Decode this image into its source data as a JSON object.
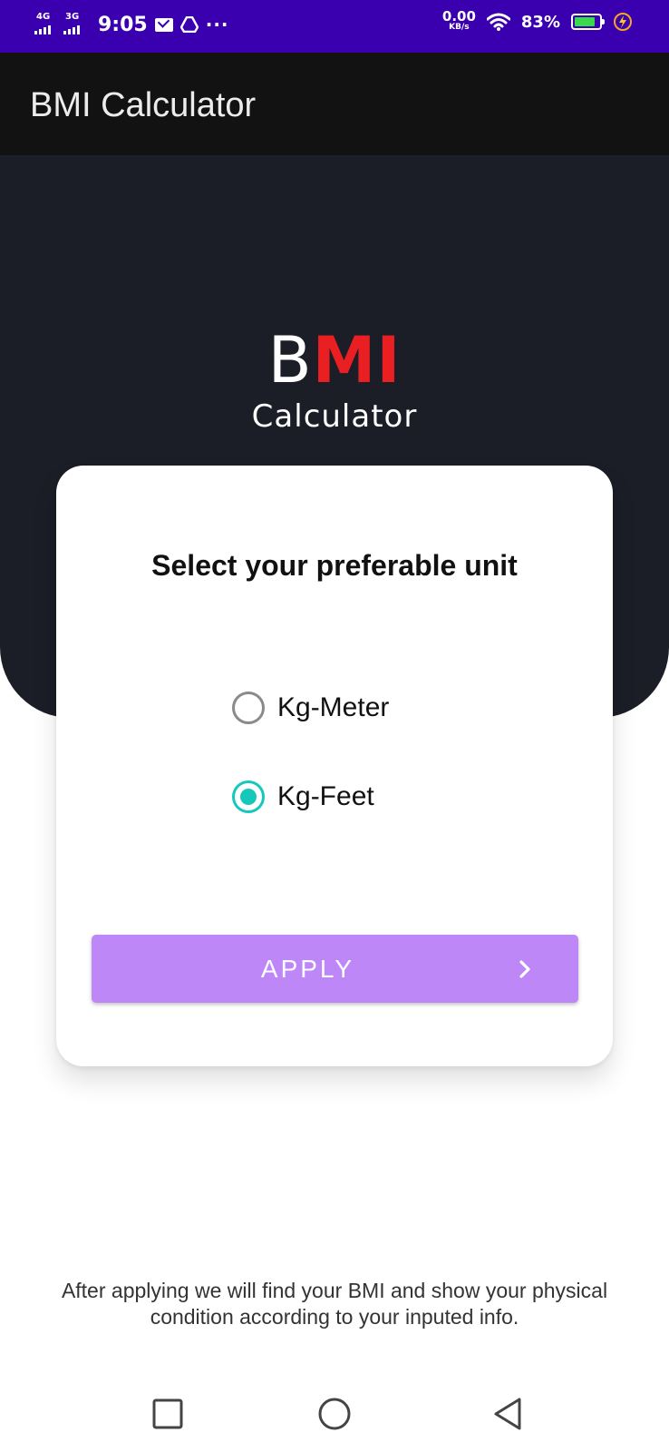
{
  "status_bar": {
    "network_1": "4G",
    "network_2": "3G",
    "time": "9:05",
    "more_indicator": "···",
    "speed_value": "0.00",
    "speed_unit": "KB/s",
    "battery_percent": "83%",
    "battery_level": 0.83,
    "icons": [
      "signal-icon",
      "mail-icon",
      "drive-icon",
      "wifi-icon",
      "battery-icon",
      "charging-icon"
    ]
  },
  "app_bar": {
    "title": "BMI Calculator"
  },
  "logo": {
    "letter_b": "B",
    "letters_mi": "MI",
    "subtitle": "Calculator"
  },
  "card": {
    "title": "Select your preferable unit",
    "options": [
      {
        "label": "Kg-Meter",
        "selected": false
      },
      {
        "label": "Kg-Feet",
        "selected": true
      }
    ],
    "apply_label": "APPLY"
  },
  "note": "After applying we will find your BMI and show your physical condition according to your inputed info.",
  "colors": {
    "status_bar": "#3a00b0",
    "app_bar": "#121212",
    "header": "#1b1d27",
    "accent_red": "#ea1f22",
    "radio_selected": "#16c8bc",
    "apply_button": "#be87f8"
  }
}
